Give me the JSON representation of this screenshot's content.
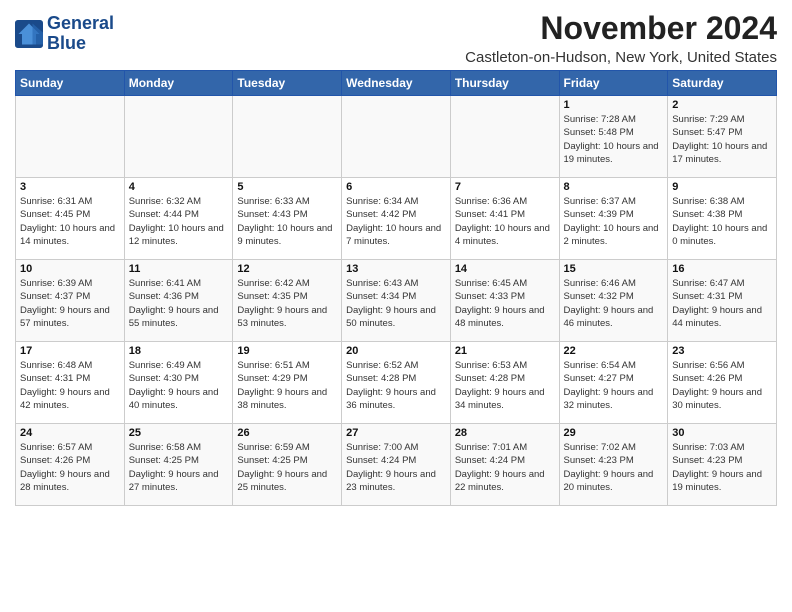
{
  "logo": {
    "line1": "General",
    "line2": "Blue"
  },
  "title": "November 2024",
  "location": "Castleton-on-Hudson, New York, United States",
  "days_of_week": [
    "Sunday",
    "Monday",
    "Tuesday",
    "Wednesday",
    "Thursday",
    "Friday",
    "Saturday"
  ],
  "weeks": [
    [
      {
        "day": "",
        "info": ""
      },
      {
        "day": "",
        "info": ""
      },
      {
        "day": "",
        "info": ""
      },
      {
        "day": "",
        "info": ""
      },
      {
        "day": "",
        "info": ""
      },
      {
        "day": "1",
        "info": "Sunrise: 7:28 AM\nSunset: 5:48 PM\nDaylight: 10 hours and 19 minutes."
      },
      {
        "day": "2",
        "info": "Sunrise: 7:29 AM\nSunset: 5:47 PM\nDaylight: 10 hours and 17 minutes."
      }
    ],
    [
      {
        "day": "3",
        "info": "Sunrise: 6:31 AM\nSunset: 4:45 PM\nDaylight: 10 hours and 14 minutes."
      },
      {
        "day": "4",
        "info": "Sunrise: 6:32 AM\nSunset: 4:44 PM\nDaylight: 10 hours and 12 minutes."
      },
      {
        "day": "5",
        "info": "Sunrise: 6:33 AM\nSunset: 4:43 PM\nDaylight: 10 hours and 9 minutes."
      },
      {
        "day": "6",
        "info": "Sunrise: 6:34 AM\nSunset: 4:42 PM\nDaylight: 10 hours and 7 minutes."
      },
      {
        "day": "7",
        "info": "Sunrise: 6:36 AM\nSunset: 4:41 PM\nDaylight: 10 hours and 4 minutes."
      },
      {
        "day": "8",
        "info": "Sunrise: 6:37 AM\nSunset: 4:39 PM\nDaylight: 10 hours and 2 minutes."
      },
      {
        "day": "9",
        "info": "Sunrise: 6:38 AM\nSunset: 4:38 PM\nDaylight: 10 hours and 0 minutes."
      }
    ],
    [
      {
        "day": "10",
        "info": "Sunrise: 6:39 AM\nSunset: 4:37 PM\nDaylight: 9 hours and 57 minutes."
      },
      {
        "day": "11",
        "info": "Sunrise: 6:41 AM\nSunset: 4:36 PM\nDaylight: 9 hours and 55 minutes."
      },
      {
        "day": "12",
        "info": "Sunrise: 6:42 AM\nSunset: 4:35 PM\nDaylight: 9 hours and 53 minutes."
      },
      {
        "day": "13",
        "info": "Sunrise: 6:43 AM\nSunset: 4:34 PM\nDaylight: 9 hours and 50 minutes."
      },
      {
        "day": "14",
        "info": "Sunrise: 6:45 AM\nSunset: 4:33 PM\nDaylight: 9 hours and 48 minutes."
      },
      {
        "day": "15",
        "info": "Sunrise: 6:46 AM\nSunset: 4:32 PM\nDaylight: 9 hours and 46 minutes."
      },
      {
        "day": "16",
        "info": "Sunrise: 6:47 AM\nSunset: 4:31 PM\nDaylight: 9 hours and 44 minutes."
      }
    ],
    [
      {
        "day": "17",
        "info": "Sunrise: 6:48 AM\nSunset: 4:31 PM\nDaylight: 9 hours and 42 minutes."
      },
      {
        "day": "18",
        "info": "Sunrise: 6:49 AM\nSunset: 4:30 PM\nDaylight: 9 hours and 40 minutes."
      },
      {
        "day": "19",
        "info": "Sunrise: 6:51 AM\nSunset: 4:29 PM\nDaylight: 9 hours and 38 minutes."
      },
      {
        "day": "20",
        "info": "Sunrise: 6:52 AM\nSunset: 4:28 PM\nDaylight: 9 hours and 36 minutes."
      },
      {
        "day": "21",
        "info": "Sunrise: 6:53 AM\nSunset: 4:28 PM\nDaylight: 9 hours and 34 minutes."
      },
      {
        "day": "22",
        "info": "Sunrise: 6:54 AM\nSunset: 4:27 PM\nDaylight: 9 hours and 32 minutes."
      },
      {
        "day": "23",
        "info": "Sunrise: 6:56 AM\nSunset: 4:26 PM\nDaylight: 9 hours and 30 minutes."
      }
    ],
    [
      {
        "day": "24",
        "info": "Sunrise: 6:57 AM\nSunset: 4:26 PM\nDaylight: 9 hours and 28 minutes."
      },
      {
        "day": "25",
        "info": "Sunrise: 6:58 AM\nSunset: 4:25 PM\nDaylight: 9 hours and 27 minutes."
      },
      {
        "day": "26",
        "info": "Sunrise: 6:59 AM\nSunset: 4:25 PM\nDaylight: 9 hours and 25 minutes."
      },
      {
        "day": "27",
        "info": "Sunrise: 7:00 AM\nSunset: 4:24 PM\nDaylight: 9 hours and 23 minutes."
      },
      {
        "day": "28",
        "info": "Sunrise: 7:01 AM\nSunset: 4:24 PM\nDaylight: 9 hours and 22 minutes."
      },
      {
        "day": "29",
        "info": "Sunrise: 7:02 AM\nSunset: 4:23 PM\nDaylight: 9 hours and 20 minutes."
      },
      {
        "day": "30",
        "info": "Sunrise: 7:03 AM\nSunset: 4:23 PM\nDaylight: 9 hours and 19 minutes."
      }
    ]
  ]
}
